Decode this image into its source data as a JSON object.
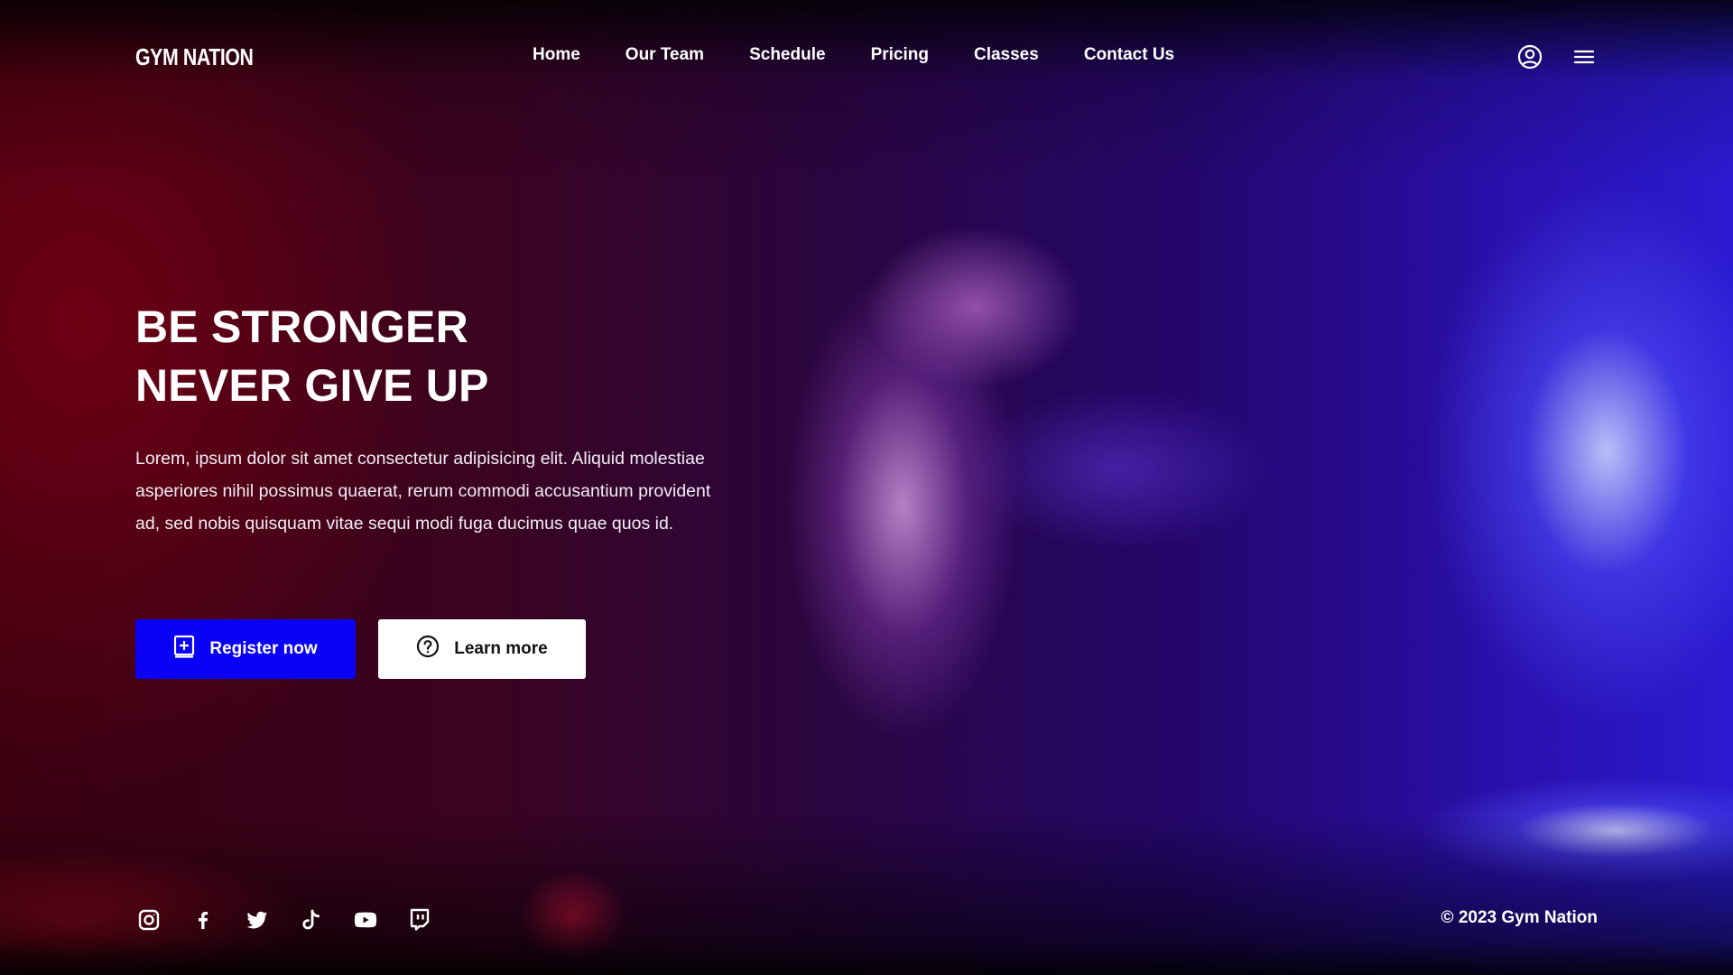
{
  "brand": {
    "name": "GYM NATION"
  },
  "nav": {
    "items": [
      {
        "label": "Home"
      },
      {
        "label": "Our Team"
      },
      {
        "label": "Schedule"
      },
      {
        "label": "Pricing"
      },
      {
        "label": "Classes"
      },
      {
        "label": "Contact Us"
      }
    ]
  },
  "header": {
    "icons": [
      "user-circle-icon",
      "hamburger-menu-icon"
    ]
  },
  "hero": {
    "headline_line1": "BE STRONGER",
    "headline_line2": "NEVER GIVE UP",
    "description": "Lorem, ipsum dolor sit amet consectetur adipisicing elit. Aliquid molestiae asperiores nihil possimus quaerat, rerum commodi accusantium provident ad, sed nobis quisquam vitae sequi modi fuga ducimus quae quos id.",
    "primary_button": {
      "label": "Register now",
      "icon": "square-plus-icon"
    },
    "secondary_button": {
      "label": "Learn more",
      "icon": "question-circle-icon"
    }
  },
  "footer": {
    "socials": [
      "instagram-icon",
      "facebook-icon",
      "twitter-icon",
      "tiktok-icon",
      "youtube-icon",
      "twitch-icon"
    ],
    "copyright": "© 2023 Gym Nation"
  },
  "colors": {
    "accent": "#0a00f5",
    "text": "#ffffff",
    "secondary_button_bg": "#ffffff"
  }
}
